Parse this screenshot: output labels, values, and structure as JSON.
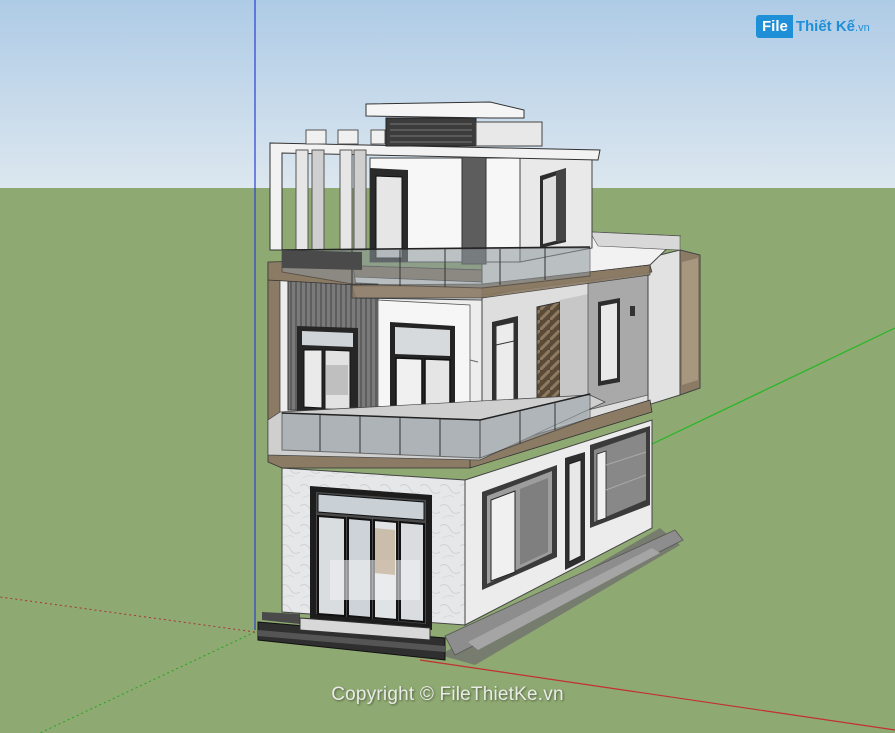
{
  "watermark": {
    "logo_file": "File",
    "logo_name": "Thiết Kế",
    "logo_tld": ".vn",
    "copyright": "Copyright © FileThietKe.vn"
  },
  "colors": {
    "sky": "#d8e4ee",
    "ground": "#8faa72",
    "wall_white": "#f4f4f4",
    "wall_gray": "#9a9a9a",
    "trim_brown": "#8b7b65",
    "glass": "#c9d0d6",
    "frame_dark": "#2a2a2a"
  }
}
